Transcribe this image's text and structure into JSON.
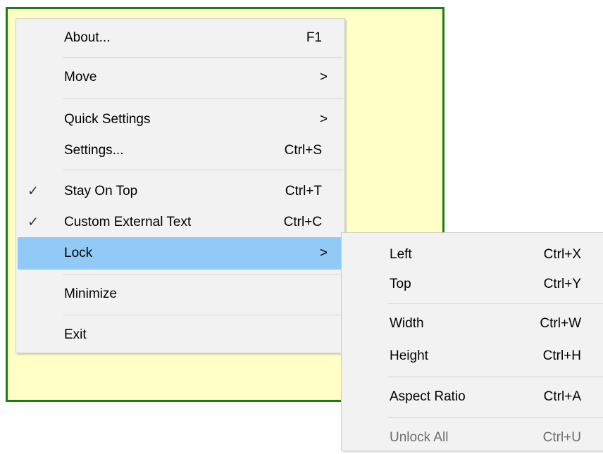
{
  "main_menu": {
    "items": [
      {
        "label": "About...",
        "shortcut": "F1"
      },
      {
        "label": "Move",
        "shortcut": ">"
      },
      {
        "label": "Quick Settings",
        "shortcut": ">"
      },
      {
        "label": "Settings...",
        "shortcut": "Ctrl+S"
      },
      {
        "label": "Stay On Top",
        "shortcut": "Ctrl+T",
        "check": "✓"
      },
      {
        "label": "Custom External Text",
        "shortcut": "Ctrl+C",
        "check": "✓"
      },
      {
        "label": "Lock",
        "shortcut": ">"
      },
      {
        "label": "Minimize",
        "shortcut": ""
      },
      {
        "label": "Exit",
        "shortcut": ""
      }
    ]
  },
  "lock_submenu": {
    "items": [
      {
        "label": "Left",
        "shortcut": "Ctrl+X"
      },
      {
        "label": "Top",
        "shortcut": "Ctrl+Y"
      },
      {
        "label": "Width",
        "shortcut": "Ctrl+W"
      },
      {
        "label": "Height",
        "shortcut": "Ctrl+H"
      },
      {
        "label": "Aspect Ratio",
        "shortcut": "Ctrl+A"
      },
      {
        "label": "Unlock All",
        "shortcut": "Ctrl+U"
      }
    ]
  },
  "colors": {
    "highlight": "#91c9f7",
    "menu_bg": "#f2f2f2",
    "note_bg": "#ffffc6",
    "note_border": "#1a7d1a"
  }
}
